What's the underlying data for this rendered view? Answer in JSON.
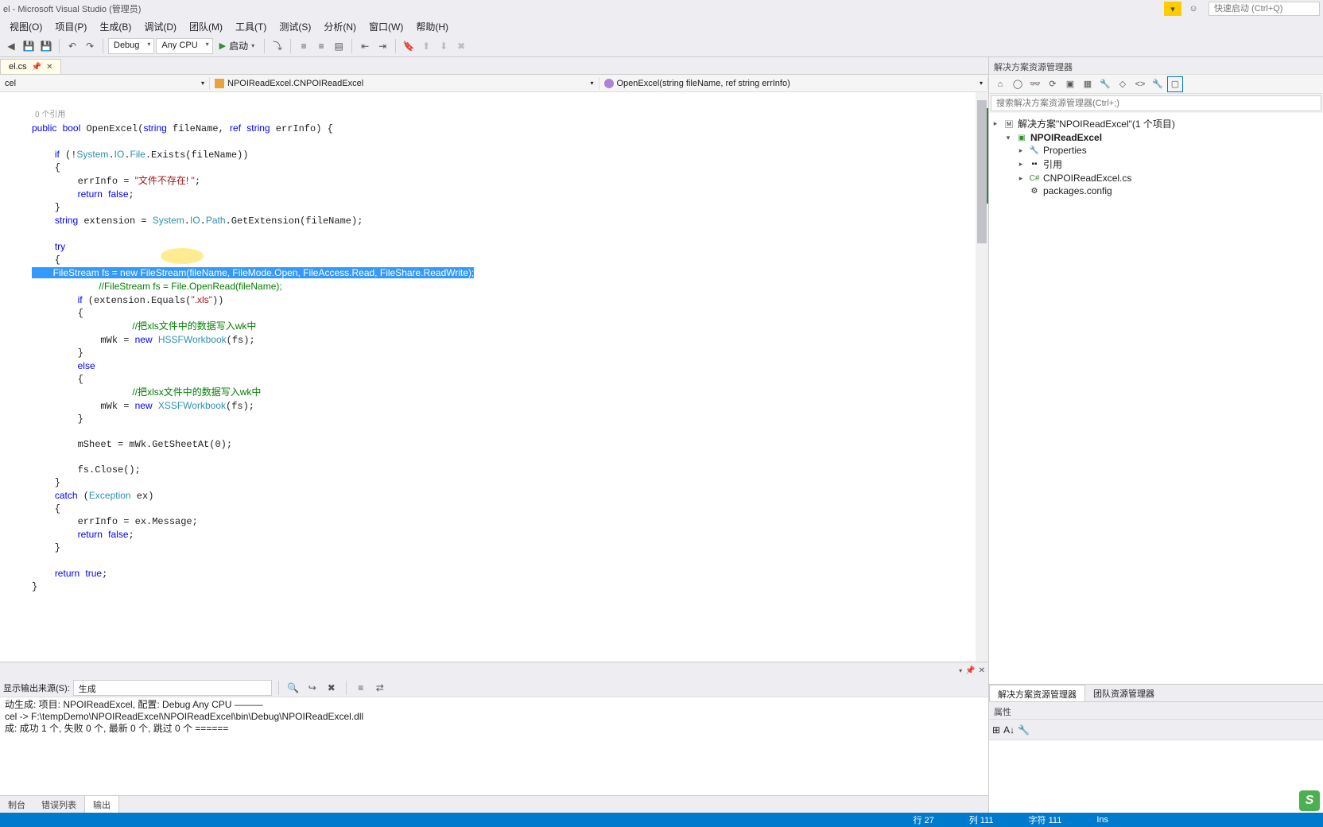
{
  "title": "el - Microsoft Visual Studio (管理员)",
  "quick_launch_placeholder": "快速启动 (Ctrl+Q)",
  "menu": [
    "视图(O)",
    "项目(P)",
    "生成(B)",
    "调试(D)",
    "团队(M)",
    "工具(T)",
    "测试(S)",
    "分析(N)",
    "窗口(W)",
    "帮助(H)"
  ],
  "toolbar": {
    "config": "Debug",
    "platform": "Any CPU",
    "start": "启动"
  },
  "tab": {
    "name": "el.cs"
  },
  "nav": {
    "left": "cel",
    "middle": "NPOIReadExcel.CNPOIReadExcel",
    "right": "OpenExcel(string fileName, ref string errInfo)"
  },
  "ref_count": "0 个引用",
  "code": {
    "l1": "public bool OpenExcel(string fileName, ref string errInfo) {",
    "l2a": "    if (!",
    "l2b": "System",
    "l2c": ".",
    "l2d": "IO",
    "l2e": ".",
    "l2f": "File",
    "l2g": ".Exists(fileName))",
    "l3": "    {",
    "l4a": "        errInfo = ",
    "l4b": "\"文件不存在! \"",
    "l4c": ";",
    "l5a": "        return ",
    "l5b": "false",
    "l5c": ";",
    "l6": "    }",
    "l7a": "    string extension = ",
    "l7b": "System",
    "l7c": ".",
    "l7d": "IO",
    "l7e": ".",
    "l7f": "Path",
    "l7g": ".GetExtension(fileName);",
    "l8a": "    try",
    "l9": "    {",
    "sel": "        FileStream fs = new FileStream(fileName, FileMode.Open, FileAccess.Read, FileShare.ReadWrite);",
    "l11": "        //FileStream fs = File.OpenRead(fileName);",
    "l12a": "        if (extension.Equals(",
    "l12b": "\".xls\"",
    "l12c": "))",
    "l13": "        {",
    "l14": "            //把xls文件中的数据写入wk中",
    "l15a": "            mWk = ",
    "l15b": "new ",
    "l15c": "HSSFWorkbook",
    "l15d": "(fs);",
    "l16": "        }",
    "l17a": "        else",
    "l18": "        {",
    "l19": "            //把xlsx文件中的数据写入wk中",
    "l20a": "            mWk = ",
    "l20b": "new ",
    "l20c": "XSSFWorkbook",
    "l20d": "(fs);",
    "l21": "        }",
    "l22": "        mSheet = mWk.GetSheetAt(0);",
    "l23": "        fs.Close();",
    "l24": "    }",
    "l25a": "    catch (",
    "l25b": "Exception",
    "l25c": " ex)",
    "l26": "    {",
    "l27": "        errInfo = ex.Message;",
    "l28a": "        return ",
    "l28b": "false",
    "l28c": ";",
    "l29": "    }",
    "l30a": "    return ",
    "l30b": "true",
    "l30c": ";",
    "l31": "}"
  },
  "output": {
    "source_label": "显示输出来源(S):",
    "source": "生成",
    "lines": [
      "动生成: 项目: NPOIReadExcel, 配置: Debug Any CPU ———",
      "cel -> F:\\tempDemo\\NPOIReadExcel\\NPOIReadExcel\\bin\\Debug\\NPOIReadExcel.dll",
      "成: 成功 1 个, 失败 0 个, 最新 0 个, 跳过 0 个 ======"
    ]
  },
  "bottom_tabs": [
    "制台",
    "错误列表",
    "输出"
  ],
  "solution": {
    "title": "解决方案资源管理器",
    "search_placeholder": "搜索解决方案资源管理器(Ctrl+;)",
    "root": "解决方案\"NPOIReadExcel\"(1 个项目)",
    "project": "NPOIReadExcel",
    "nodes": [
      "Properties",
      "引用",
      "CNPOIReadExcel.cs",
      "packages.config"
    ],
    "tabs": [
      "解决方案资源管理器",
      "团队资源管理器"
    ]
  },
  "props": {
    "title": "属性"
  },
  "status": {
    "line": "行 27",
    "col": "列 111",
    "char": "字符 111",
    "ins": "Ins"
  }
}
